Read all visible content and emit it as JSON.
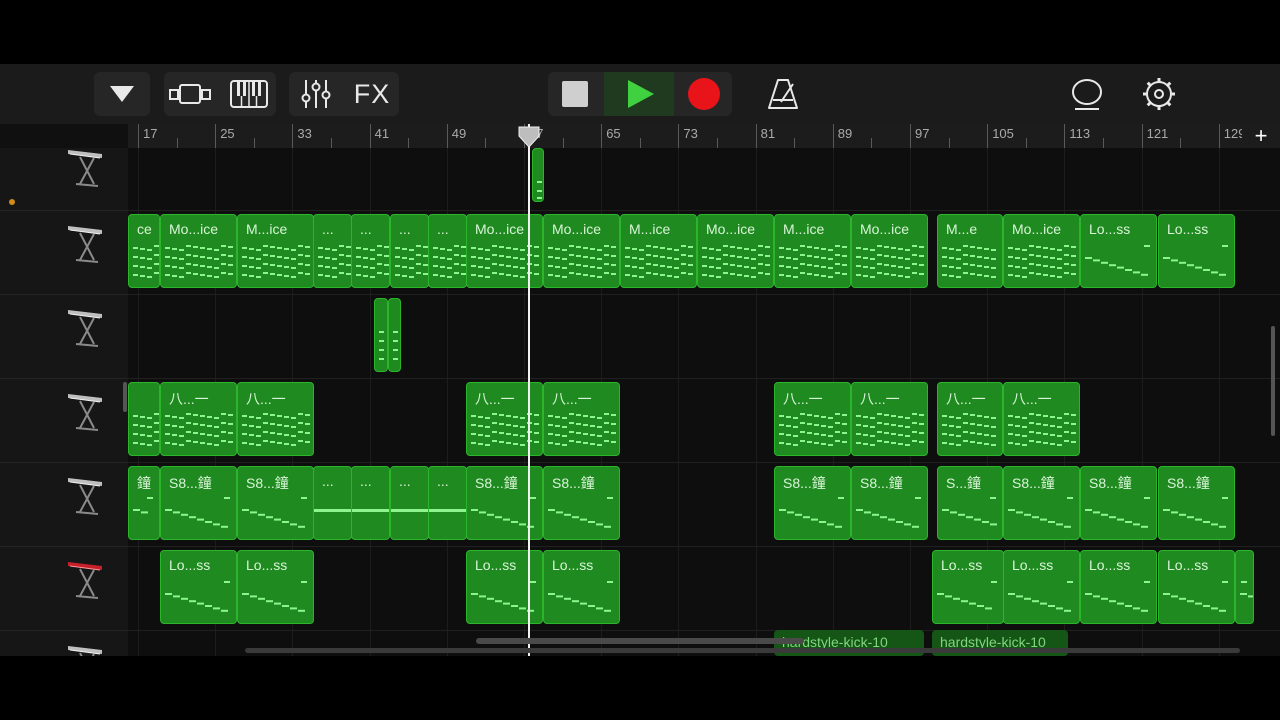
{
  "toolbar": {
    "menu_icon": "triangle-down-icon",
    "tracks_view_icon": "tracks-view-icon",
    "keyboard_icon": "piano-keyboard-icon",
    "mixer_icon": "mixer-sliders-icon",
    "fx_label": "FX",
    "stop_icon": "stop-icon",
    "play_icon": "play-icon",
    "record_icon": "record-icon",
    "metronome_icon": "metronome-icon",
    "loop_icon": "loop-browser-icon",
    "settings_icon": "gear-icon"
  },
  "ruler": {
    "labels": [
      "17",
      "25",
      "33",
      "41",
      "49",
      "57",
      "65",
      "73",
      "81",
      "89",
      "97",
      "105",
      "113",
      "121",
      "129"
    ],
    "add_track_label": "+"
  },
  "colors": {
    "region_fill": "#1f8a1f",
    "region_border": "#2bb52b",
    "note_color": "#8ef58e",
    "record_red": "#e8141a",
    "play_green": "#3fd13f"
  },
  "tracks": [
    {
      "instrument_icon": "keyboard-stand-icon",
      "regions": [
        {
          "label": ""
        }
      ]
    },
    {
      "instrument_icon": "keyboard-stand-icon",
      "regions": [
        {
          "label": "ce"
        },
        {
          "label": "Mo...ice"
        },
        {
          "label": "M...ice"
        },
        {
          "label": "..."
        },
        {
          "label": "..."
        },
        {
          "label": "..."
        },
        {
          "label": "..."
        },
        {
          "label": "Mo...ice"
        },
        {
          "label": "Mo...ice"
        },
        {
          "label": "M...ice"
        },
        {
          "label": "Mo...ice"
        },
        {
          "label": "M...ice"
        },
        {
          "label": "Mo...ice"
        },
        {
          "label": "M...e"
        },
        {
          "label": "Mo...ice"
        },
        {
          "label": "Lo...ss"
        },
        {
          "label": "Lo...ss"
        }
      ]
    },
    {
      "instrument_icon": "keyboard-stand-icon",
      "regions": [
        {
          "label": ""
        },
        {
          "label": ""
        }
      ]
    },
    {
      "instrument_icon": "keyboard-stand-icon",
      "regions": [
        {
          "label": ""
        },
        {
          "label": "八...一"
        },
        {
          "label": "八...一"
        },
        {
          "label": "八...一"
        },
        {
          "label": "八...一"
        },
        {
          "label": "八...一"
        },
        {
          "label": "八...一"
        },
        {
          "label": "八...一"
        },
        {
          "label": "八...一"
        }
      ]
    },
    {
      "instrument_icon": "keyboard-stand-icon",
      "regions": [
        {
          "label": "鐘"
        },
        {
          "label": "S8...鐘"
        },
        {
          "label": "S8...鐘"
        },
        {
          "label": "..."
        },
        {
          "label": "..."
        },
        {
          "label": "..."
        },
        {
          "label": "..."
        },
        {
          "label": "S8...鐘"
        },
        {
          "label": "S8...鐘"
        },
        {
          "label": "S8...鐘"
        },
        {
          "label": "S8...鐘"
        },
        {
          "label": "S...鐘"
        },
        {
          "label": "S8...鐘"
        },
        {
          "label": "S8...鐘"
        },
        {
          "label": "S8...鐘"
        }
      ]
    },
    {
      "instrument_icon": "red-synth-keyboard-icon",
      "regions": [
        {
          "label": "Lo...ss"
        },
        {
          "label": "Lo...ss"
        },
        {
          "label": "Lo...ss"
        },
        {
          "label": "Lo...ss"
        },
        {
          "label": "Lo...ss"
        },
        {
          "label": "Lo...ss"
        },
        {
          "label": "Lo...ss"
        },
        {
          "label": "Lo...ss"
        },
        {
          "label": ""
        }
      ]
    },
    {
      "instrument_icon": "keyboard-stand-icon",
      "regions": [
        {
          "label": "hardstyle-kick-10"
        },
        {
          "label": "hardstyle-kick-10"
        }
      ]
    }
  ]
}
